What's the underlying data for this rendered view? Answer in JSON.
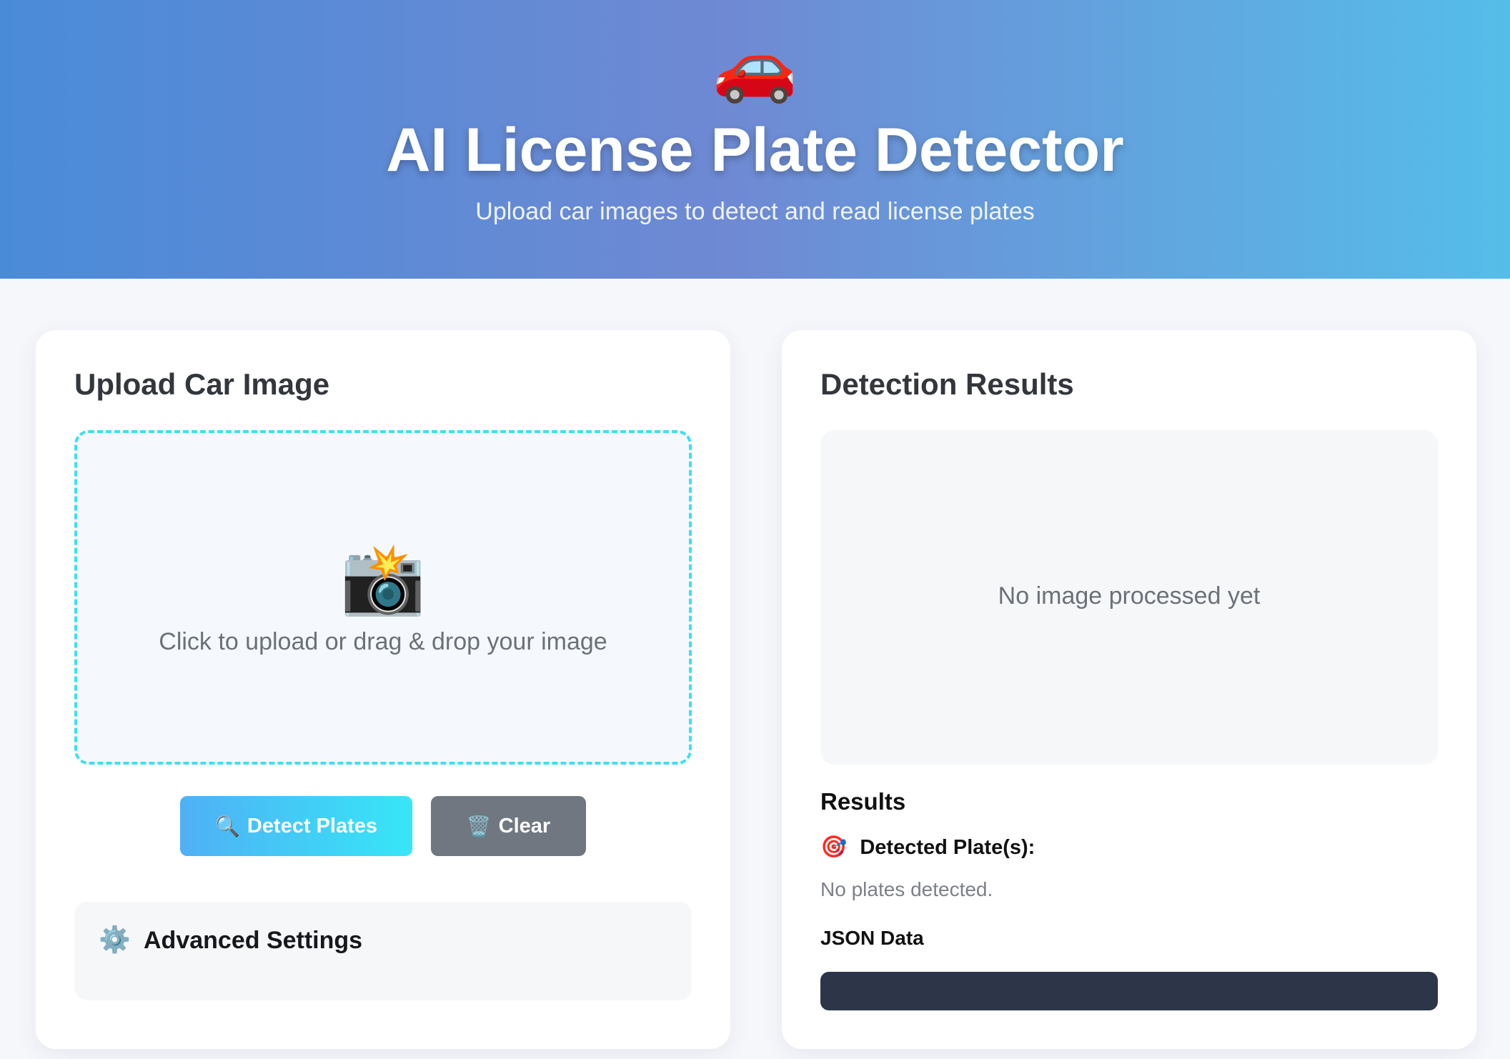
{
  "header": {
    "logo_icon": "🚗",
    "title": "AI License Plate Detector",
    "subtitle": "Upload car images to detect and read license plates"
  },
  "upload_panel": {
    "title": "Upload Car Image",
    "dropzone_icon": "📸",
    "dropzone_hint": "Click to upload or drag & drop your image",
    "detect_button": {
      "icon": "🔍",
      "label": "Detect Plates"
    },
    "clear_button": {
      "icon": "🗑️",
      "label": "Clear"
    },
    "advanced_settings": {
      "icon": "⚙️",
      "label": "Advanced Settings"
    }
  },
  "results_panel": {
    "title": "Detection Results",
    "preview_empty": "No image processed yet",
    "results_heading": "Results",
    "detected_plates_icon": "🎯",
    "detected_plates_label": "Detected Plate(s):",
    "no_plates_text": "No plates detected.",
    "json_heading": "JSON Data",
    "json_content": ""
  },
  "colors": {
    "header_gradient_start": "#4a8bd8",
    "header_gradient_end": "#55bde9",
    "dropzone_border": "#3ee0ee",
    "detect_button_start": "#4fb0f5",
    "detect_button_end": "#37e6f7",
    "clear_button": "#707780",
    "json_box": "#2d3648"
  }
}
